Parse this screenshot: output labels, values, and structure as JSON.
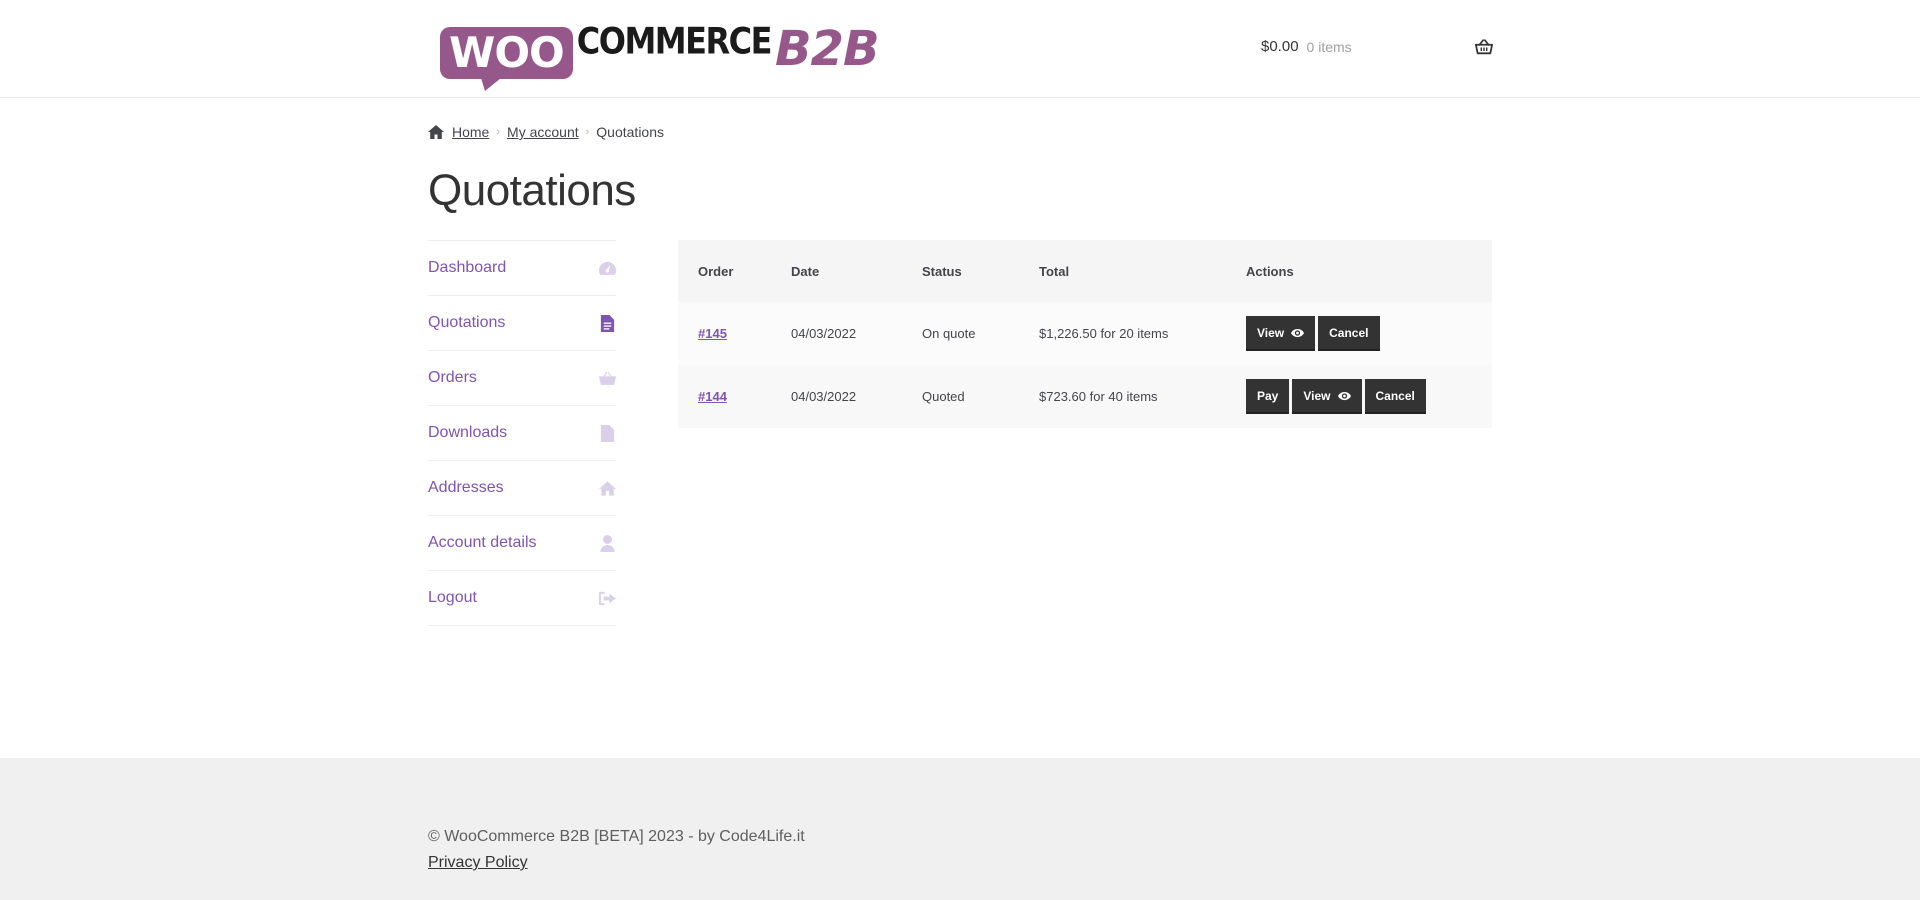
{
  "header": {
    "logo": {
      "woo": "WOO",
      "commerce": "COMMERCE",
      "b2b": "B2B"
    },
    "cart": {
      "amount": "$0.00",
      "count": "0 items",
      "icon": "basket-icon"
    }
  },
  "breadcrumb": {
    "home": "Home",
    "account": "My account",
    "current": "Quotations"
  },
  "page": {
    "title": "Quotations"
  },
  "nav": {
    "items": [
      {
        "label": "Dashboard",
        "icon": "dashboard-icon"
      },
      {
        "label": "Quotations",
        "icon": "file-icon",
        "active": true
      },
      {
        "label": "Orders",
        "icon": "basket-icon"
      },
      {
        "label": "Downloads",
        "icon": "file-download-icon"
      },
      {
        "label": "Addresses",
        "icon": "home-icon"
      },
      {
        "label": "Account details",
        "icon": "user-icon"
      },
      {
        "label": "Logout",
        "icon": "logout-icon"
      }
    ]
  },
  "table": {
    "headers": {
      "order": "Order",
      "date": "Date",
      "status": "Status",
      "total": "Total",
      "actions": "Actions"
    },
    "rows": [
      {
        "order": "#145",
        "date": "04/03/2022",
        "status": "On quote",
        "total": "$1,226.50 for 20 items"
      },
      {
        "order": "#144",
        "date": "04/03/2022",
        "status": "Quoted",
        "total": "$723.60 for 40 items"
      }
    ],
    "buttons": {
      "pay": "Pay",
      "view": "View",
      "cancel": "Cancel"
    }
  },
  "footer": {
    "copyright": "© WooCommerce B2B [BETA] 2023 - by Code4Life.it",
    "privacy": "Privacy Policy"
  },
  "colors": {
    "brand": "#96588a",
    "link": "#7f54b3",
    "button": "#333333",
    "footer_bg": "#f0f0f0"
  }
}
